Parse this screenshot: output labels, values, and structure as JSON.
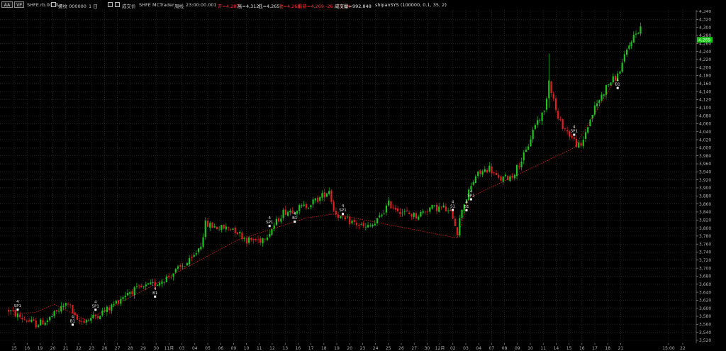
{
  "toolbar": {
    "symbol_button": "AA",
    "mode_button": "VP",
    "contract": "SHFE.rb.0000",
    "interval_label": "螺纹 000000",
    "period_label": "1 日",
    "price_type": "成交价",
    "exchange": "SHFE",
    "source": "MCTrader",
    "session_label": "周线",
    "time": "23:00:00.001",
    "open": "开=4,287",
    "high": "高=4,312",
    "low": "低=4,265",
    "close": "收=4,269",
    "change": "最新=4,269 -26 -0.60%",
    "volume": "成交量=992,848",
    "strategy": "shipanSYS (100000, 0.1, 35, 2)"
  },
  "colors": {
    "background": "#000000",
    "grid": "#3a3a3a",
    "up": "#1fc41f",
    "down": "#e02020",
    "trend_line": "#e02020",
    "current_price_bg": "#19c419",
    "label_text": "#e6e6e6",
    "axis_text": "#b0b0b0"
  },
  "price_axis": {
    "ticks": [
      "4,340",
      "4,320",
      "4,300",
      "4,280",
      "4,260",
      "4,240",
      "4,220",
      "4,200",
      "4,180",
      "4,160",
      "4,140",
      "4,120",
      "4,100",
      "4,080",
      "4,060",
      "4,040",
      "4,020",
      "4,000",
      "3,980",
      "3,960",
      "3,940",
      "3,920",
      "3,900",
      "3,880",
      "3,860",
      "3,840",
      "3,820",
      "3,800",
      "3,780",
      "3,760",
      "3,740",
      "3,720",
      "3,700",
      "3,680",
      "3,660",
      "3,640",
      "3,620",
      "3,600",
      "3,580",
      "3,560",
      "3,540",
      "3,520"
    ],
    "current_price": "4,269",
    "min": 3520,
    "max": 4340
  },
  "time_axis": {
    "labels": [
      "15",
      "16",
      "19",
      "20",
      "21",
      "22",
      "23",
      "26",
      "27",
      "28",
      "29",
      "30",
      "11月",
      "03",
      "04",
      "05",
      "06",
      "09",
      "10",
      "11",
      "12",
      "13",
      "16",
      "17",
      "18",
      "19",
      "20",
      "23",
      "24",
      "25",
      "26",
      "27",
      "30",
      "12月",
      "02",
      "03",
      "04",
      "07",
      "08",
      "09",
      "10",
      "11",
      "14",
      "15",
      "16",
      "17",
      "18",
      "21",
      "15:00",
      "22"
    ]
  },
  "chart_data": {
    "type": "candlestick",
    "title": "",
    "series_name": "SHFE.rb.0000",
    "ylim": [
      3520,
      4340
    ],
    "anchors": [
      [
        0,
        3595
      ],
      [
        6,
        3575
      ],
      [
        12,
        3560
      ],
      [
        17,
        3570
      ],
      [
        22,
        3595
      ],
      [
        26,
        3615
      ],
      [
        30,
        3565
      ],
      [
        36,
        3575
      ],
      [
        44,
        3600
      ],
      [
        52,
        3640
      ],
      [
        58,
        3650
      ],
      [
        64,
        3660
      ],
      [
        70,
        3680
      ],
      [
        76,
        3705
      ],
      [
        80,
        3720
      ],
      [
        84,
        3760
      ],
      [
        86,
        3810
      ],
      [
        92,
        3800
      ],
      [
        98,
        3800
      ],
      [
        104,
        3770
      ],
      [
        110,
        3770
      ],
      [
        114,
        3790
      ],
      [
        120,
        3840
      ],
      [
        124,
        3845
      ],
      [
        130,
        3855
      ],
      [
        136,
        3875
      ],
      [
        140,
        3895
      ],
      [
        142,
        3845
      ],
      [
        146,
        3820
      ],
      [
        150,
        3815
      ],
      [
        156,
        3800
      ],
      [
        160,
        3810
      ],
      [
        166,
        3860
      ],
      [
        172,
        3840
      ],
      [
        178,
        3830
      ],
      [
        184,
        3850
      ],
      [
        190,
        3850
      ],
      [
        194,
        3830
      ],
      [
        196,
        3790
      ],
      [
        198,
        3850
      ],
      [
        200,
        3875
      ],
      [
        204,
        3930
      ],
      [
        210,
        3950
      ],
      [
        214,
        3920
      ],
      [
        220,
        3930
      ],
      [
        226,
        3990
      ],
      [
        230,
        4060
      ],
      [
        234,
        4090
      ],
      [
        236,
        4170
      ],
      [
        240,
        4070
      ],
      [
        244,
        4040
      ],
      [
        248,
        4010
      ],
      [
        250,
        4000
      ],
      [
        252,
        4040
      ],
      [
        256,
        4100
      ],
      [
        262,
        4160
      ],
      [
        266,
        4180
      ],
      [
        270,
        4240
      ],
      [
        272,
        4270
      ],
      [
        276,
        4300
      ]
    ],
    "ohlc_last": {
      "open": 4287,
      "high": 4312,
      "low": 4265,
      "close": 4269
    },
    "volume_last": 992848,
    "trend_line": [
      [
        2,
        3585
      ],
      [
        12,
        3590
      ],
      [
        20,
        3610
      ],
      [
        34,
        3570
      ],
      [
        54,
        3630
      ],
      [
        100,
        3770
      ],
      [
        130,
        3825
      ],
      [
        142,
        3835
      ],
      [
        196,
        3775
      ],
      [
        201,
        3875
      ],
      [
        212,
        3905
      ],
      [
        247,
        4000
      ],
      [
        266,
        4180
      ]
    ],
    "signals": [
      {
        "i": 4,
        "label": "SP1",
        "num": "4",
        "pos": "above"
      },
      {
        "i": 28,
        "label": "B1",
        "num": "4",
        "pos": "below"
      },
      {
        "i": 38,
        "label": "SP1",
        "num": "4",
        "pos": "above"
      },
      {
        "i": 64,
        "label": "B1",
        "num": "4",
        "pos": "below"
      },
      {
        "i": 114,
        "label": "SP1",
        "num": "4",
        "pos": "above"
      },
      {
        "i": 125,
        "label": "B1",
        "num": "4",
        "pos": "below"
      },
      {
        "i": 146,
        "label": "SP1",
        "num": "4",
        "pos": "above"
      },
      {
        "i": 194,
        "label": "S1",
        "num": "4",
        "pos": "above"
      },
      {
        "i": 200,
        "label": "B1",
        "num": "4",
        "pos": "below"
      },
      {
        "i": 202,
        "label": "SP1",
        "num": "4",
        "pos": "below"
      },
      {
        "i": 247,
        "label": "SP1",
        "num": "4",
        "pos": "above"
      },
      {
        "i": 266,
        "label": "B1",
        "num": "4",
        "pos": "below"
      }
    ]
  }
}
